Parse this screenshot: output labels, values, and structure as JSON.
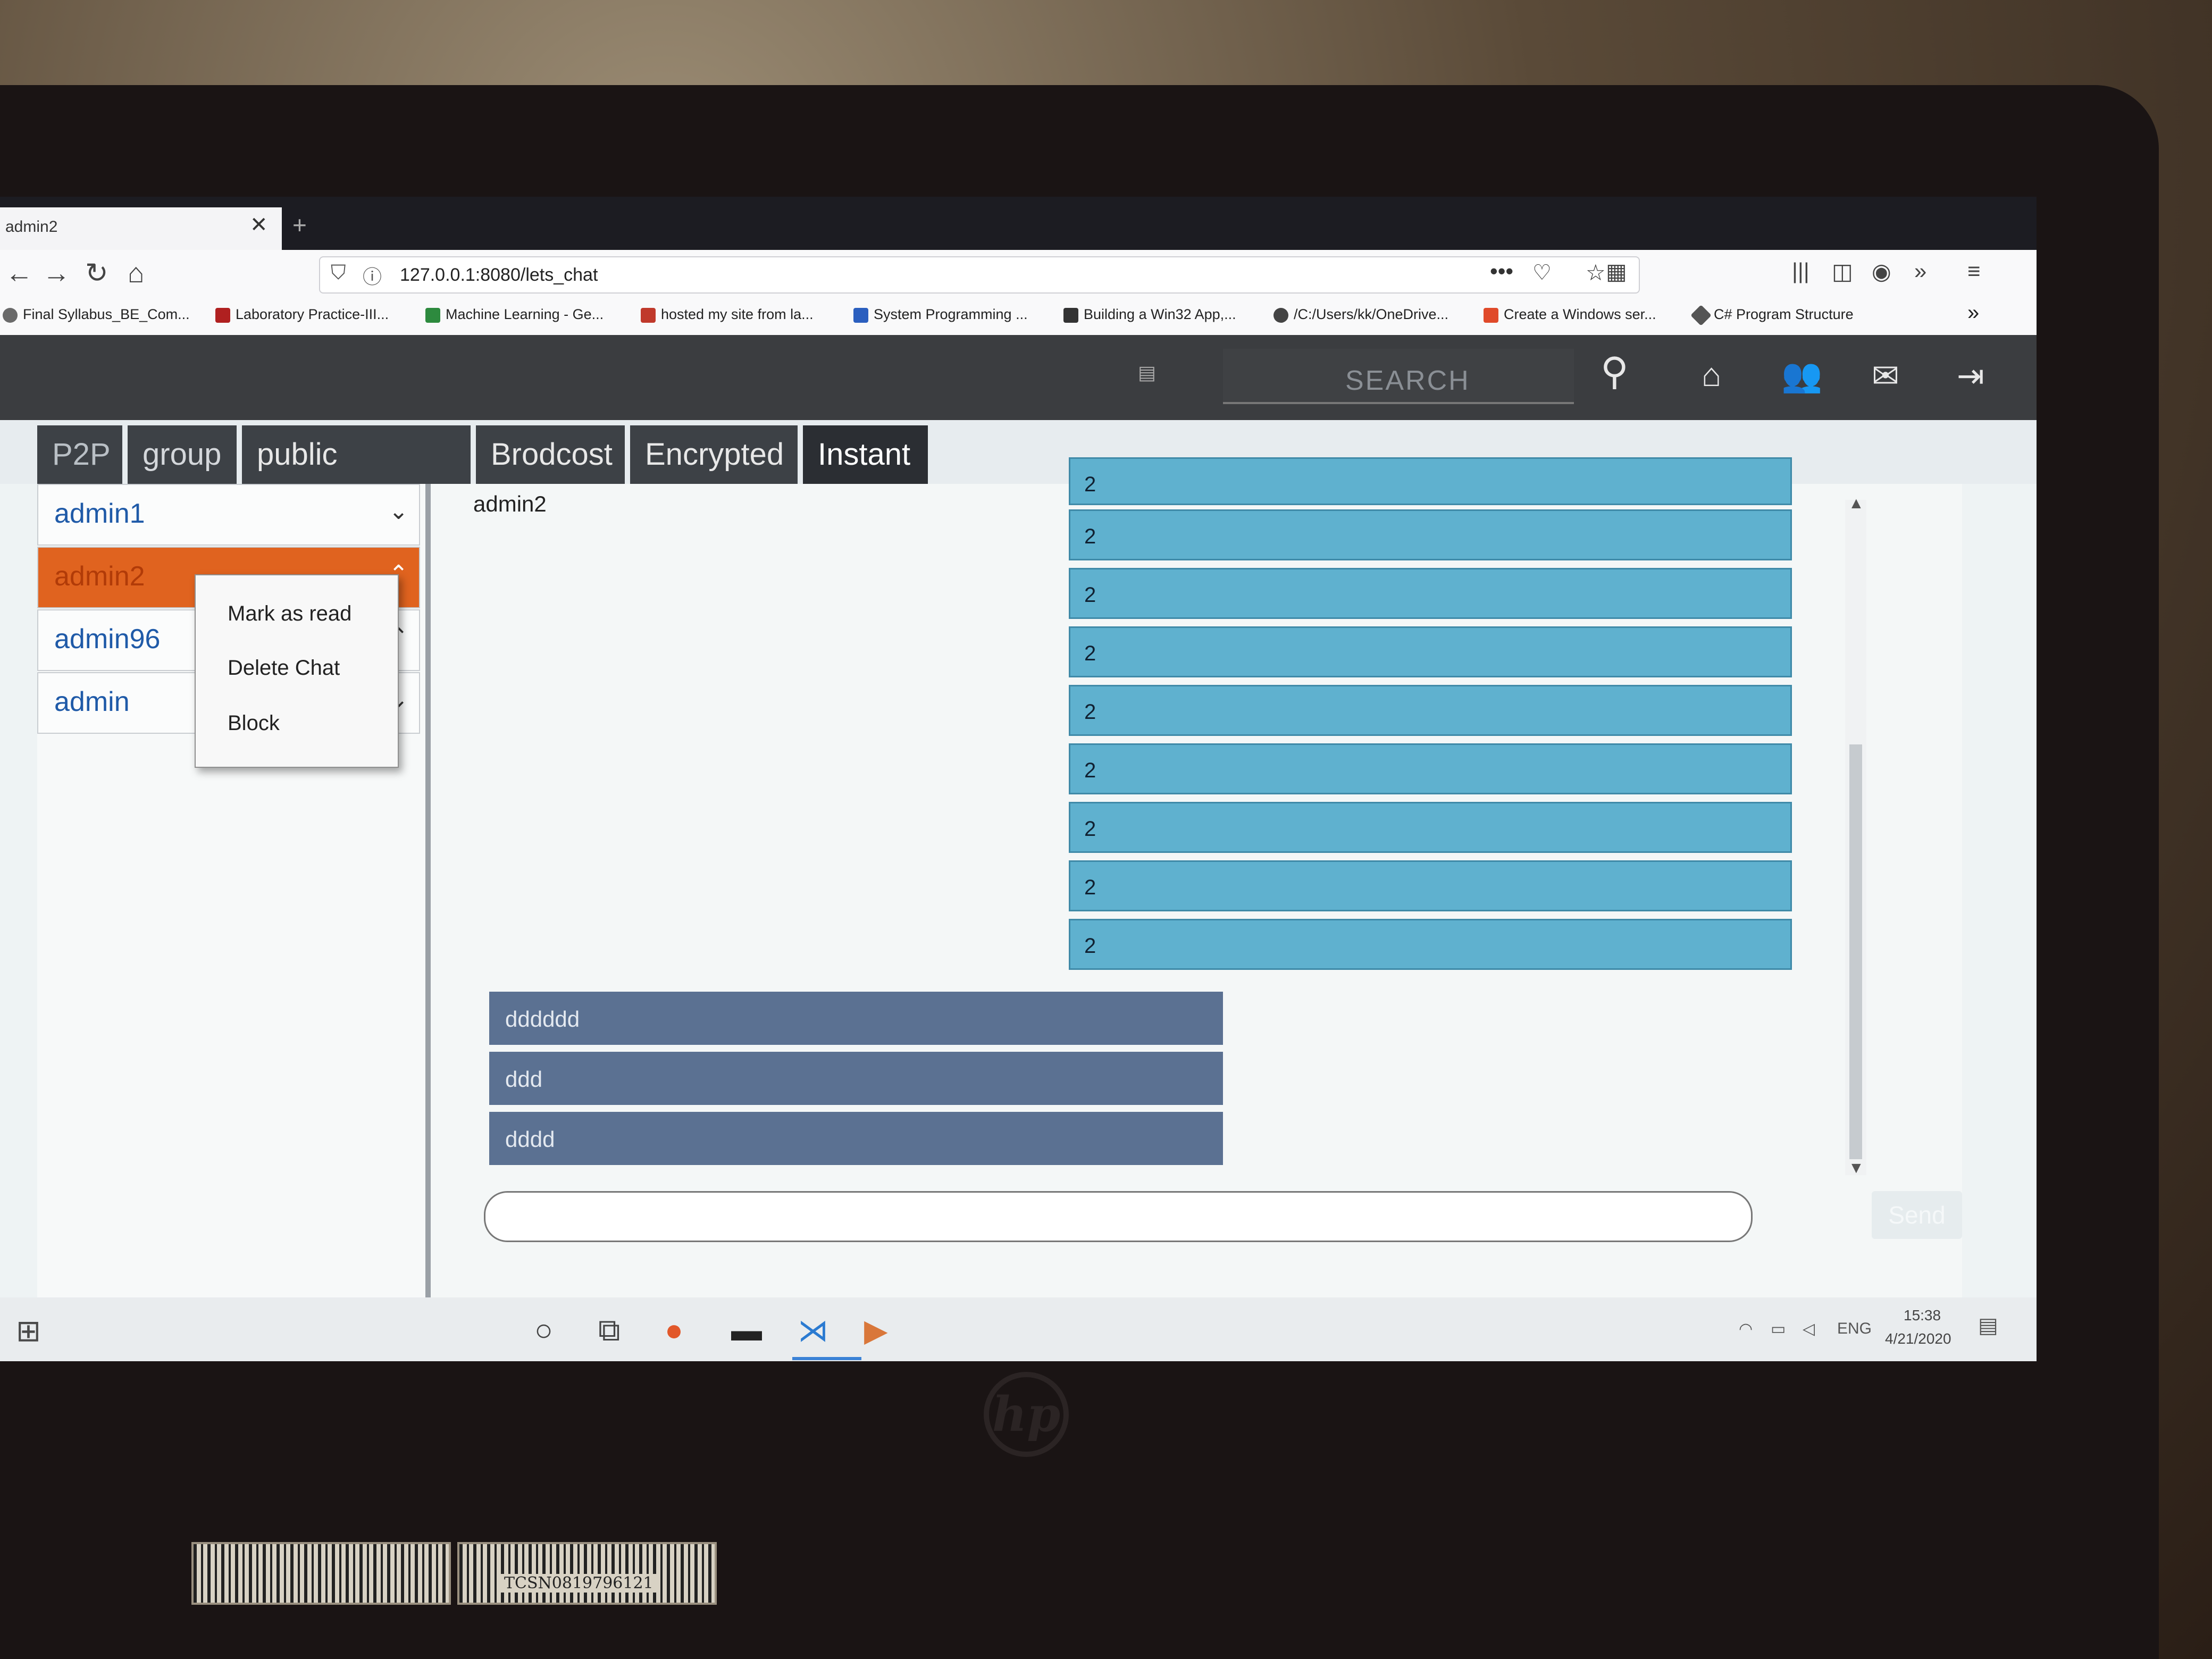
{
  "browser": {
    "tab_title": "admin2",
    "tab_close": "✕",
    "new_tab": "+",
    "url": "127.0.0.1:8080/lets_chat",
    "more": "•••"
  },
  "bookmarks": [
    {
      "label": "Final Syllabus_BE_Com...",
      "icon_color": "#6a6a6a"
    },
    {
      "label": "Laboratory Practice-III...",
      "icon_color": "#b02020"
    },
    {
      "label": "Machine Learning - Ge...",
      "icon_color": "#2d8a3e"
    },
    {
      "label": "hosted my site from la...",
      "icon_color": "#c0392b"
    },
    {
      "label": "System Programming ...",
      "icon_color": "#2b5fbf"
    },
    {
      "label": "Building a Win32 App,...",
      "icon_color": "#333333"
    },
    {
      "label": "/C:/Users/kk/OneDrive...",
      "icon_color": "#444444"
    },
    {
      "label": "Create a Windows ser...",
      "icon_color": "#e04a2a"
    },
    {
      "label": "C# Program Structure",
      "icon_color": "#555555"
    }
  ],
  "header": {
    "search_placeholder": "SEARCH",
    "icons": [
      "search-icon",
      "home-icon",
      "users-icon",
      "mail-icon",
      "logout-icon"
    ]
  },
  "chat_tabs": [
    "P2P",
    "group",
    "public brodcast",
    "Brodcost",
    "Encrypted",
    "Instant"
  ],
  "users": [
    "admin1",
    "admin2",
    "admin96",
    "admin"
  ],
  "context_menu": [
    "Mark as read",
    "Delete Chat",
    "Block"
  ],
  "chat": {
    "recipient": "admin2",
    "incoming": [
      "2",
      "2",
      "2",
      "2",
      "2",
      "2",
      "2",
      "2",
      "2"
    ],
    "outgoing": [
      "dddddd",
      "ddd",
      "dddd"
    ],
    "input_value": "",
    "send_label": "Send"
  },
  "taskbar": {
    "language": "ENG",
    "time": "15:38",
    "date": "4/21/2020"
  },
  "photo": {
    "sticker_text": "TCSN0819796121",
    "brand": "hp"
  },
  "colors": {
    "selected_user": "#e0631f",
    "incoming_bubble": "#5fb1cf",
    "outgoing_bubble": "#5b7192",
    "header_bg": "#3b3d40"
  }
}
